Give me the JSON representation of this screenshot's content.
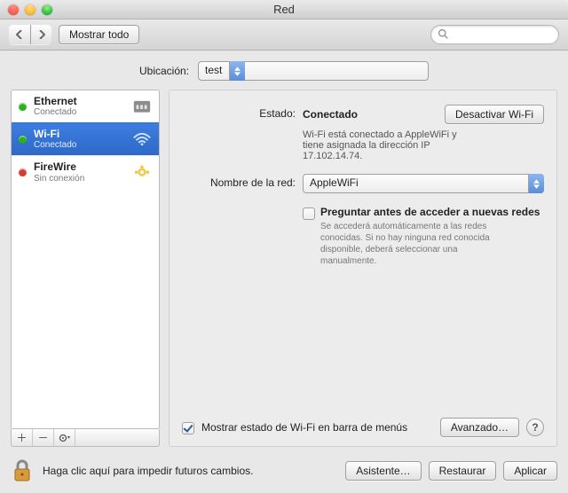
{
  "window": {
    "title": "Red"
  },
  "toolbar": {
    "show_all": "Mostrar todo",
    "search_placeholder": ""
  },
  "location": {
    "label": "Ubicación:",
    "value": "test"
  },
  "sidebar": {
    "items": [
      {
        "name": "Ethernet",
        "status_label": "Conectado",
        "status_color": "green",
        "icon": "ethernet"
      },
      {
        "name": "Wi-Fi",
        "status_label": "Conectado",
        "status_color": "green",
        "icon": "wifi",
        "selected": true
      },
      {
        "name": "FireWire",
        "status_label": "Sin conexión",
        "status_color": "red",
        "icon": "firewire"
      }
    ]
  },
  "panel": {
    "status_label": "Estado:",
    "status_value": "Conectado",
    "turn_off_button": "Desactivar Wi-Fi",
    "status_description": "Wi-Fi está conectado a AppleWiFi y tiene asignada la dirección IP 17.102.14.74.",
    "network_name_label": "Nombre de la red:",
    "network_name_value": "AppleWiFi",
    "ask_checkbox": {
      "checked": false,
      "label": "Preguntar antes de acceder a nuevas redes",
      "description": "Se accederá automáticamente a las redes conocidas. Si no hay ninguna red conocida disponible, deberá seleccionar una manualmente."
    },
    "footer": {
      "show_in_menubar": {
        "checked": true,
        "label": "Mostrar estado de Wi-Fi en barra de menús"
      },
      "advanced": "Avanzado…",
      "help": "?"
    }
  },
  "bottom": {
    "lock_text": "Haga clic aquí para impedir futuros cambios.",
    "assistant": "Asistente…",
    "revert": "Restaurar",
    "apply": "Aplicar"
  }
}
